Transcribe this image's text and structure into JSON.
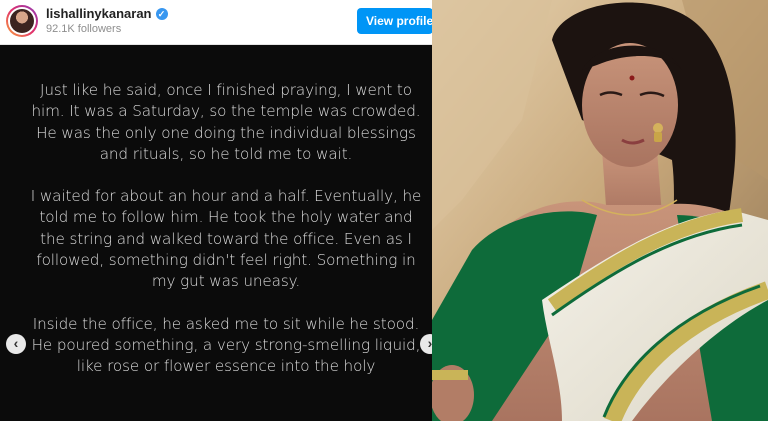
{
  "header": {
    "username": "lishallinykanaran",
    "verified_icon": "verified-badge-icon",
    "followers": "92.1K followers",
    "view_profile_label": "View profile"
  },
  "post": {
    "paragraphs": [
      "Just like he said, once I finished praying, I went to him. It was a Saturday, so the temple was crowded. He was the only one doing the individual blessings and rituals, so he told me to wait.",
      "I waited for about an hour and a half. Eventually, he told me to follow him. He took the holy water and the string and walked toward the office. Even as I followed, something didn't feel right. Something in my gut was uneasy.",
      "Inside the office, he asked me to sit while he stood. He poured something, a very strong-smelling liquid, like rose or flower essence into the holy"
    ],
    "prev_icon": "chevron-left-icon",
    "next_icon": "chevron-right-icon"
  },
  "colors": {
    "post_background": "#0b0b0b",
    "button_blue": "#0095f6",
    "saree_green": "#0e6b3a",
    "saree_gold": "#c9b458"
  }
}
